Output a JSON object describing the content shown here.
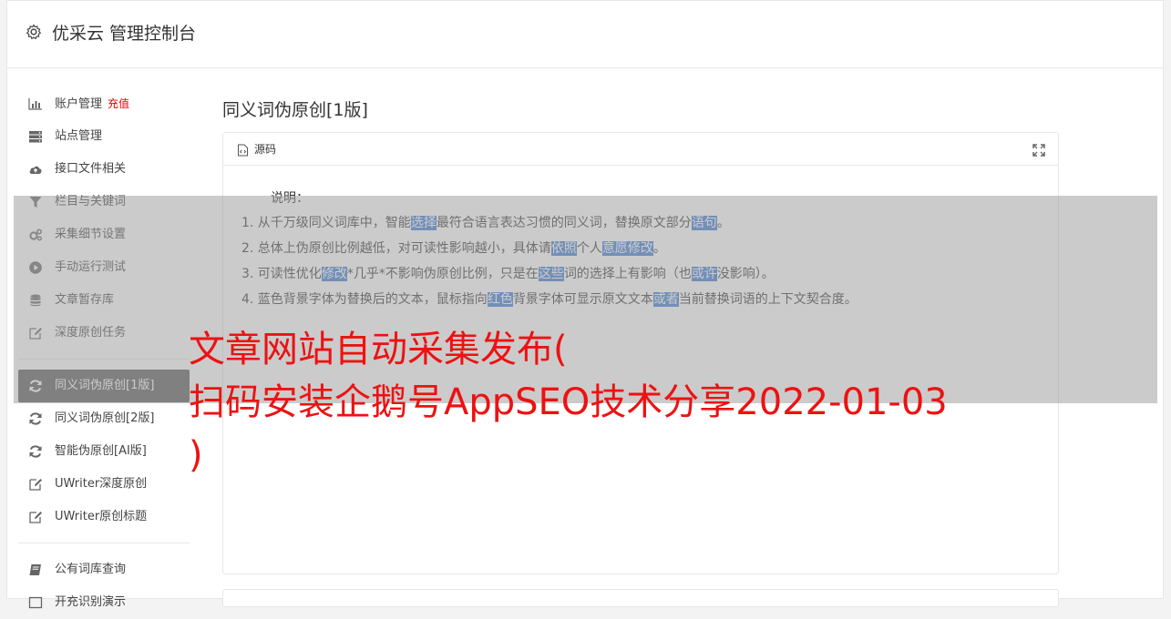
{
  "app": {
    "title": "优采云 管理控制台"
  },
  "sidebar": {
    "group1": [
      {
        "label": "账户管理",
        "badge": "充值",
        "icon": "bar-chart-icon"
      },
      {
        "label": "站点管理",
        "icon": "server-icon"
      },
      {
        "label": "接口文件相关",
        "icon": "cloud-upload-icon"
      },
      {
        "label": "栏目与关键词",
        "icon": "filter-icon"
      },
      {
        "label": "采集细节设置",
        "icon": "cogs-icon"
      },
      {
        "label": "手动运行测试",
        "icon": "play-circle-icon"
      },
      {
        "label": "文章暂存库",
        "icon": "database-icon"
      },
      {
        "label": "深度原创任务",
        "icon": "edit-icon"
      }
    ],
    "group2": [
      {
        "label": "同义词伪原创[1版]",
        "icon": "refresh-icon",
        "active": true
      },
      {
        "label": "同义词伪原创[2版]",
        "icon": "refresh-icon"
      },
      {
        "label": "智能伪原创[AI版]",
        "icon": "refresh-icon"
      },
      {
        "label": "UWriter深度原创",
        "icon": "edit-icon"
      },
      {
        "label": "UWriter原创标题",
        "icon": "edit-icon"
      }
    ],
    "group3": [
      {
        "label": "公有词库查询",
        "icon": "book-icon"
      },
      {
        "label": "开充识别演示",
        "icon": "square-icon"
      }
    ]
  },
  "main": {
    "page_title": "同义词伪原创[1版]",
    "panel": {
      "label": "源码",
      "note_heading": "说明：",
      "lines": [
        {
          "parts": [
            {
              "t": "1. 从千万级同义词库中，智能"
            },
            {
              "t": "选择",
              "hl": true
            },
            {
              "t": "最符合语言表达习惯的同义词，替换原文部分"
            },
            {
              "t": "语句",
              "hl": true
            },
            {
              "t": "。"
            }
          ]
        },
        {
          "parts": [
            {
              "t": "2. 总体上伪原创比例越低，对可读性影响越小，具体请"
            },
            {
              "t": "依照",
              "hl": true
            },
            {
              "t": "个人"
            },
            {
              "t": "意愿",
              "hl": true
            },
            {
              "t": ""
            },
            {
              "t": "修改",
              "hl": true
            },
            {
              "t": "。"
            }
          ]
        },
        {
          "parts": [
            {
              "t": "3. 可读性优化"
            },
            {
              "t": "修改",
              "hl": true
            },
            {
              "t": "*几乎*不影响伪原创比例，只是在"
            },
            {
              "t": "这些",
              "hl": true
            },
            {
              "t": "词的选择上有影响（也"
            },
            {
              "t": "或许",
              "hl": true
            },
            {
              "t": "没影响）。"
            }
          ]
        },
        {
          "parts": [
            {
              "t": "4. 蓝色背景字体为替换后的文本，鼠标指向"
            },
            {
              "t": "红色",
              "hl": true
            },
            {
              "t": "背景字体可显示原文文本"
            },
            {
              "t": "或者",
              "hl": true
            },
            {
              "t": "当前替换词语的上下文契合度。"
            }
          ]
        }
      ]
    }
  },
  "overlay": {
    "line1": "文章网站自动采集发布(",
    "line2": "扫码安装企鹅号AppSEO技术分享2022-01-03",
    "line3": ")"
  },
  "colors": {
    "highlight": "#3b7bd6",
    "active_nav": "#5a5a5a",
    "headline": "#ee1111",
    "badge": "#ee0000"
  }
}
